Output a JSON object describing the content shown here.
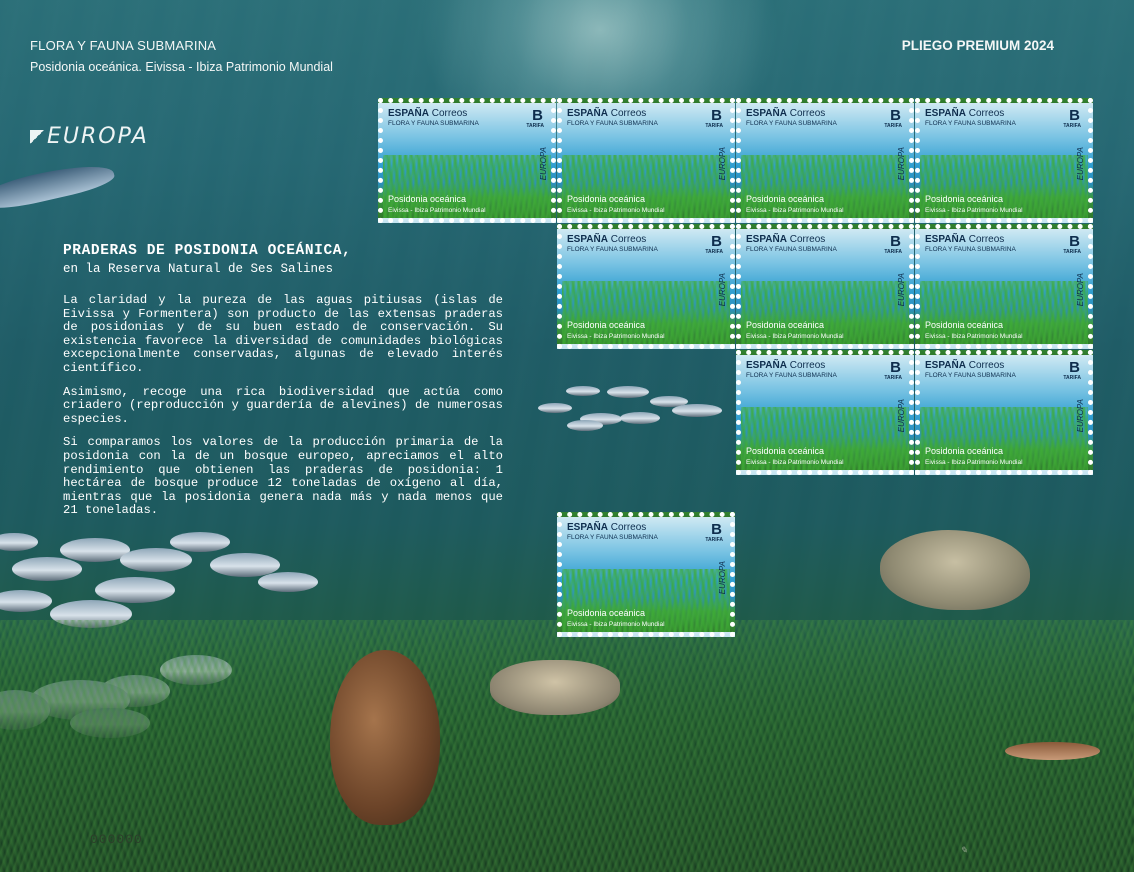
{
  "header": {
    "title": "FLORA Y FAUNA SUBMARINA",
    "subtitle": "Posidonia oceánica. Eivissa - Ibiza Patrimonio Mundial",
    "right_title": "PLIEGO PREMIUM 2024",
    "logo_text": "EUROPA"
  },
  "text": {
    "heading": "PRADERAS DE POSIDONIA OCEÁNICA,",
    "subheading": "en la Reserva Natural de Ses Salines",
    "paragraphs": [
      "La claridad y la pureza de las aguas pitiusas (islas de Eivissa y Formentera) son producto de las extensas praderas de posidonias y de su buen estado de conservación. Su existencia favorece la diversidad de comunidades biológicas excepcionalmente conservadas, algunas de elevado interés científico.",
      "Asimismo, recoge una rica biodiversidad que actúa como criadero (reproducción y guardería de alevines) de numerosas especies.",
      "Si comparamos los valores de la producción primaria de la posidonia con la de un bosque europeo, apreciamos el alto rendimiento que obtienen las praderas de posidonia: 1 hectárea de bosque produce 12 toneladas de oxígeno al día, mientras que la posidonia genera nada más y nada menos que 21 toneladas."
    ]
  },
  "stamp": {
    "country": "ESPAÑA",
    "service": "Correos",
    "series": "FLORA Y FAUNA SUBMARINA",
    "rate": "B",
    "rate_label": "TARIFA",
    "europa": "EUROPA",
    "name": "Posidonia oceánica",
    "place": "Eivissa - Ibiza Patrimonio Mundial",
    "count": 10
  },
  "serial": "000000",
  "colors": {
    "sea": "#266873",
    "text": "#ffffff",
    "stamp_text": "#0e2d4d"
  }
}
